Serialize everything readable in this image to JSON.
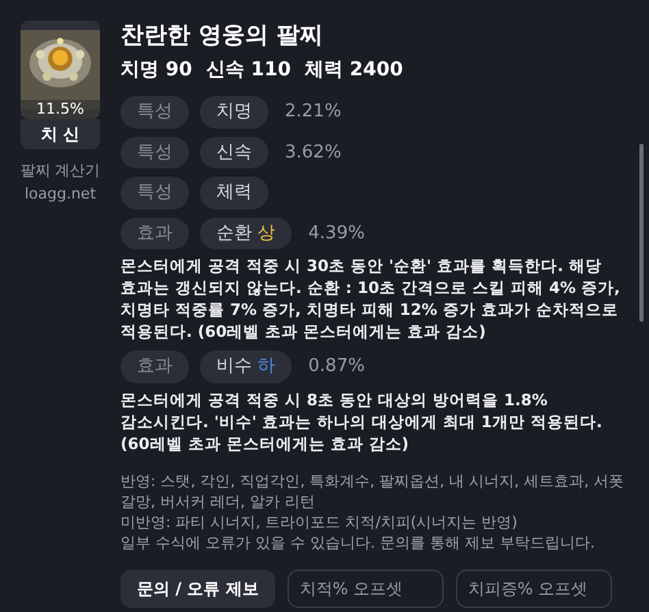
{
  "item": {
    "kind": "picture",
    "rate": "11.5%",
    "tag": "치 신",
    "calculator": "팔찌 계산기",
    "site": "loagg.net"
  },
  "title": "찬란한 영웅의 팔찌",
  "stats": [
    {
      "name": "치명",
      "value": "90"
    },
    {
      "name": "신속",
      "value": "110"
    },
    {
      "name": "체력",
      "value": "2400"
    }
  ],
  "options": [
    {
      "category": "특성",
      "name": "치명",
      "value": "2.21%"
    },
    {
      "category": "특성",
      "name": "신속",
      "value": "3.62%"
    },
    {
      "category": "특성",
      "name": "체력"
    },
    {
      "category": "효과",
      "name": "순환",
      "grade": "상",
      "color": "#e8c040",
      "value": "4.39%",
      "description": "몬스터에게 공격 적중 시 30초 동안 '순환' 효과를 획득한다. 해당 효과는 갱신되지 않는다. 순환 : 10초 간격으로 스킬 피해 4% 증가, 치명타 적중률 7% 증가, 치명타 피해 12% 증가 효과가 순차적으로 적용된다. (60레벨 초과 몬스터에게는 효과 감소)"
    },
    {
      "category": "효과",
      "name": "비수",
      "grade": "하",
      "color": "#4a8fe8",
      "value": "0.87%",
      "description": "몬스터에게 공격 적중 시 8초 동안 대상의 방어력을 1.8% 감소시킨다. '비수' 효과는 하나의 대상에게 최대 1개만 적용된다. (60레벨 초과 몬스터에게는 효과 감소)"
    }
  ],
  "notes": [
    "반영: 스탯, 각인, 직업각인, 특화계수, 팔찌옵션, 내 시너지, 세트효과, 서폿 갈망, 버서커 레더, 알카 리턴",
    "미반영: 파티 시너지, 트라이포드 치적/치피(시너지는 반영)",
    "일부 수식에 오류가 있을 수 있습니다. 문의를 통해 제보 부탁드립니다."
  ],
  "report_button": "문의 / 오류 제보",
  "fields": [
    {
      "placeholder": "치적% 오프셋"
    },
    {
      "placeholder": "치피증% 오프셋"
    }
  ]
}
